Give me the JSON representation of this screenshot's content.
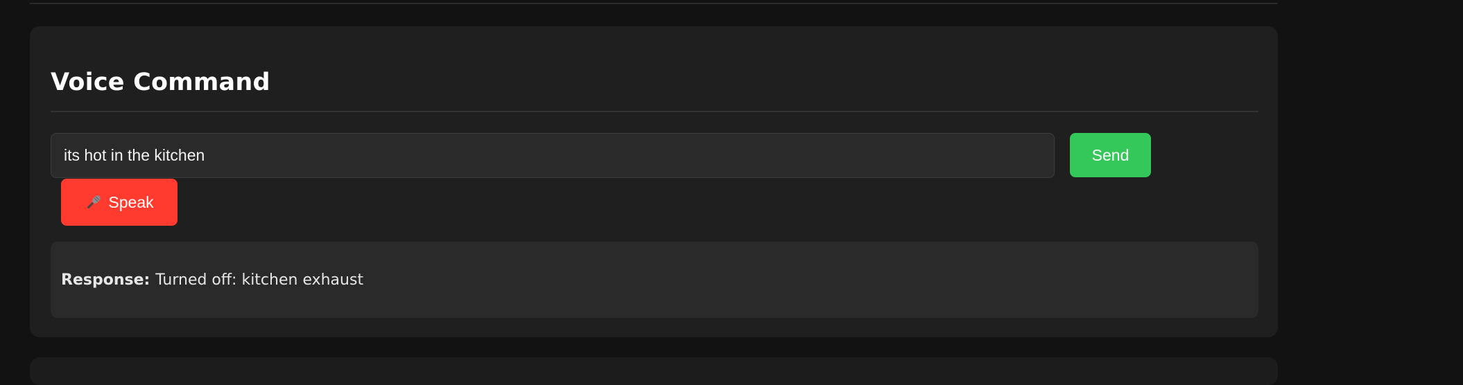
{
  "voice_command": {
    "title": "Voice Command",
    "input_value": "its hot in the kitchen",
    "send_label": "Send",
    "speak_label": "Speak",
    "speak_icon": "microphone-icon",
    "response_label": "Response:",
    "response_text": "Turned off: kitchen exhaust"
  },
  "colors": {
    "background": "#121212",
    "card": "#1f1f1f",
    "send_button": "#34c759",
    "speak_button": "#ff3b30",
    "response_panel": "#2a2a2a"
  }
}
